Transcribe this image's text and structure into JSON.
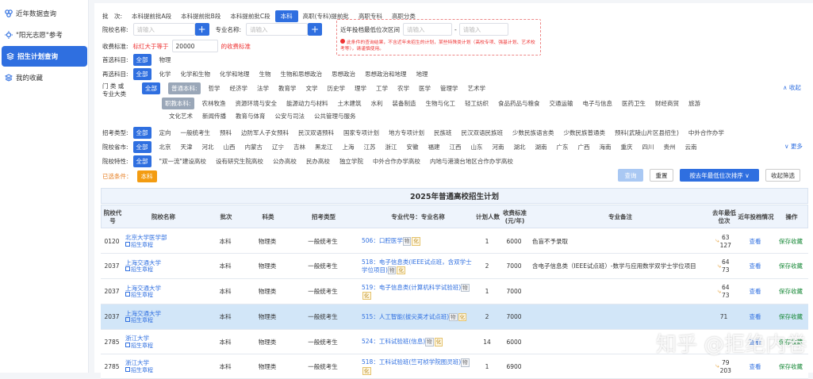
{
  "sidebar": {
    "items": [
      {
        "label": "近年数据查询"
      },
      {
        "label": "\"阳光志愿\"参考"
      },
      {
        "label": "招生计划查询"
      },
      {
        "label": "我的收藏"
      }
    ]
  },
  "filters": {
    "batch": {
      "label": "批　次:",
      "options": [
        "本科提前批A段",
        "本科提前批B段",
        "本科提前批C段",
        "本科",
        "高职(专科)提前批",
        "高职专科",
        "高职分类"
      ]
    },
    "school_name": {
      "label": "院校名称:",
      "placeholder": "请输入"
    },
    "major_name": {
      "label": "专业名称:",
      "placeholder": "请输入"
    },
    "rank_range": {
      "label": "近年投档最低位次区间",
      "placeholder": "请输入",
      "dash": "-",
      "note": "此条件的查询结果，不含近年未招生的计划，某些特殊类计划（高校专项、强基计划、艺术校考等），请谨慎使用。"
    },
    "fee": {
      "label": "收费标准:",
      "red_label": "标红大于等于",
      "value": "20000",
      "suffix": "的收费标准"
    },
    "first_subject": {
      "label": "首选科目:",
      "all": "全部",
      "options": [
        "物理"
      ]
    },
    "second_subject": {
      "label": "再选科目:",
      "all": "全部",
      "options": [
        "化学",
        "化学和生物",
        "化学和地理",
        "生物",
        "生物和思想政治",
        "思想政治",
        "思想政治和地理",
        "地理"
      ]
    },
    "category": {
      "label1": "门 类 或",
      "label2": "专业大类",
      "all": "全部",
      "undergrad_tag": "普通本科:",
      "undergrad": [
        "哲学",
        "经济学",
        "法学",
        "教育学",
        "文学",
        "历史学",
        "理学",
        "工学",
        "农学",
        "医学",
        "管理学",
        "艺术学"
      ],
      "collapse": "∧ 收起",
      "vocational_tag": "职教本科:",
      "vocational": [
        "农林牧渔",
        "资源环境与安全",
        "能源动力与材料",
        "土木建筑",
        "水利",
        "装备制造",
        "生物与化工",
        "轻工纺织",
        "食品药品与粮食",
        "交通运输",
        "电子与信息",
        "医药卫生",
        "财经商贸",
        "旅游"
      ],
      "vocational2": [
        "文化艺术",
        "新闻传播",
        "教育与体育",
        "公安与司法",
        "公共管理与服务"
      ]
    },
    "type": {
      "label": "招考类型:",
      "all": "全部",
      "options": [
        "定向",
        "一般统考生",
        "预科",
        "边防军人子女预科",
        "民汉双语预科",
        "国家专项计划",
        "地方专项计划",
        "民族班",
        "民汉双语民族班",
        "少数民族语言类",
        "少数民族普通类",
        "预科(武陵山片区县招生)",
        "中外合作办学"
      ]
    },
    "province": {
      "label": "院校省市:",
      "all": "全部",
      "options": [
        "北京",
        "天津",
        "河北",
        "山西",
        "内蒙古",
        "辽宁",
        "吉林",
        "黑龙江",
        "上海",
        "江苏",
        "浙江",
        "安徽",
        "福建",
        "江西",
        "山东",
        "河南",
        "湖北",
        "湖南",
        "广东",
        "广西",
        "海南",
        "重庆",
        "四川",
        "贵州",
        "云南"
      ],
      "more": "∨ 更多"
    },
    "feature": {
      "label": "院校特性:",
      "all": "全部",
      "options": [
        "\"双一流\"建设高校",
        "设有研究生院高校",
        "公办高校",
        "民办高校",
        "独立学院",
        "中外合作办学高校",
        "内地与港澳台地区合作办学高校"
      ]
    },
    "selected": {
      "label": "已选条件：",
      "tag": "本科"
    },
    "buttons": {
      "query": "查询",
      "reset": "重置",
      "sort": "按去年最低位次排序 ∨",
      "collapse_filter": "收起筛选"
    }
  },
  "table": {
    "title": "2025年普通高校招生计划",
    "headers": {
      "code": "院校代号",
      "name": "院校名称",
      "batch": "批次",
      "subject": "科类",
      "type": "招考类型",
      "major": "专业代号：专业名称",
      "plan": "计划人数",
      "fee": "收费标准(元/年)",
      "remark": "专业备注",
      "rank": "去年最低位次",
      "trend": "近年投档情况",
      "op": "操作"
    },
    "rows": [
      {
        "code": "0120",
        "name": "北京大学医学部",
        "charter": "招生章程",
        "batch": "本科",
        "subject": "物理类",
        "type": "一般统考生",
        "major": "506：口腔医学",
        "b1": "物",
        "b2": "化",
        "plan": "1",
        "fee": "6000",
        "remark": "色盲不予录取",
        "r1": "63",
        "r2": "127",
        "trend": "查看",
        "op": "保存收藏"
      },
      {
        "code": "2037",
        "name": "上海交通大学",
        "charter": "招生章程",
        "batch": "本科",
        "subject": "物理类",
        "type": "一般统考生",
        "major": "518：电子信息类(IEEE试点班，含双学士学位项目)",
        "b1": "物",
        "b2": "化",
        "plan": "2",
        "fee": "7000",
        "remark": "含电子信息类（IEEE试点班）-数学与应用数学双学士学位项目",
        "r1": "64",
        "r2": "73",
        "trend": "查看",
        "op": "保存收藏"
      },
      {
        "code": "2037",
        "name": "上海交通大学",
        "charter": "招生章程",
        "batch": "本科",
        "subject": "物理类",
        "type": "一般统考生",
        "major": "519：电子信息类(计算机科学试验班)",
        "b1": "物",
        "b2": "化",
        "plan": "1",
        "fee": "7000",
        "remark": "",
        "r1": "64",
        "r2": "73",
        "trend": "查看",
        "op": "保存收藏"
      },
      {
        "code": "2037",
        "name": "上海交通大学",
        "charter": "招生章程",
        "batch": "本科",
        "subject": "物理类",
        "type": "一般统考生",
        "major": "515：人工智能(拔尖英才试点班)",
        "b1": "物",
        "b2": "化",
        "plan": "2",
        "fee": "7000",
        "remark": "",
        "r1": "71",
        "r2": "",
        "trend": "查看",
        "op": "保存收藏"
      },
      {
        "code": "2785",
        "name": "浙江大学",
        "charter": "招生章程",
        "batch": "本科",
        "subject": "物理类",
        "type": "一般统考生",
        "major": "524：工科试验班(信息)",
        "b1": "物",
        "b2": "化",
        "plan": "14",
        "fee": "6000",
        "remark": "",
        "r1": "",
        "r2": "",
        "trend": "查看",
        "op": "保存收藏"
      },
      {
        "code": "2785",
        "name": "浙江大学",
        "charter": "招生章程",
        "batch": "本科",
        "subject": "物理类",
        "type": "一般统考生",
        "major": "518：工科试验班(竺可桢学院图灵班)",
        "b1": "物",
        "b2": "化",
        "plan": "1",
        "fee": "6900",
        "remark": "",
        "r1": "79",
        "r2": "203",
        "trend": "查看",
        "op": "保存收藏"
      }
    ]
  },
  "watermark": "知乎 @拒绝内卷"
}
